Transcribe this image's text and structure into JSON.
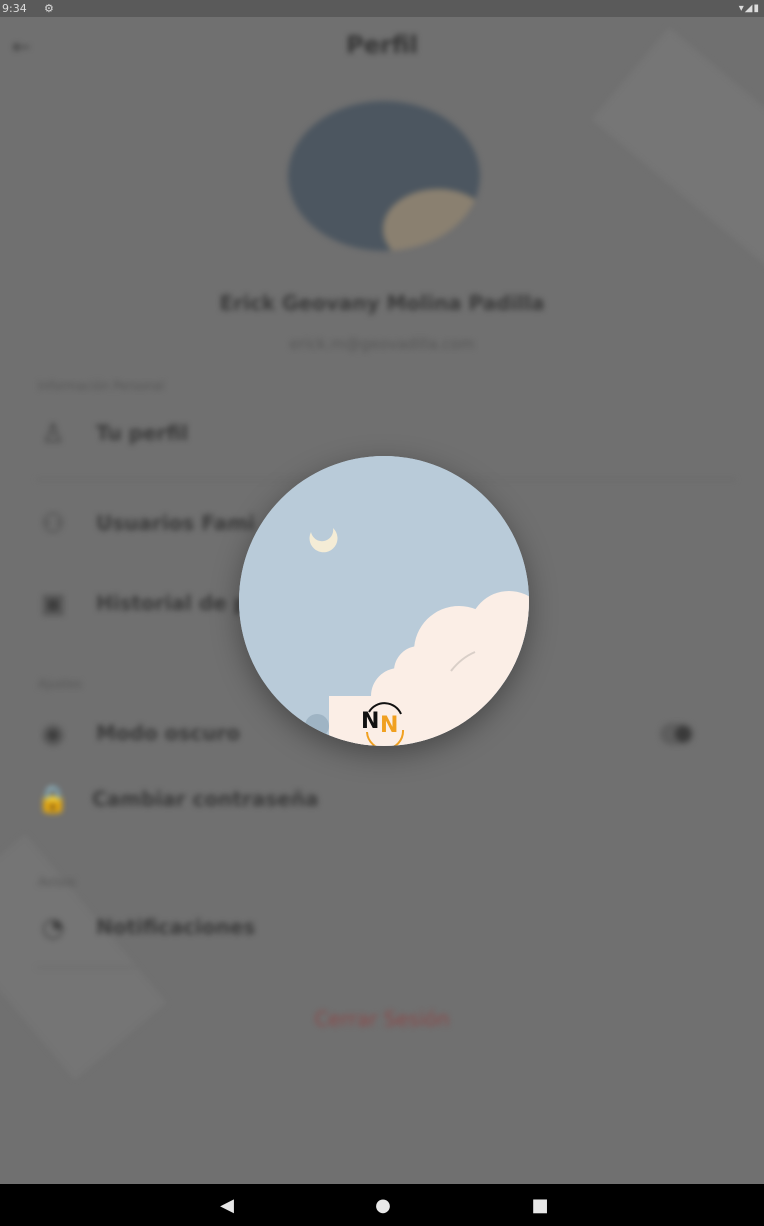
{
  "status_bar": {
    "time": "9:34",
    "settings_icon": "gear-icon",
    "system_icons": "wifi-icon signal-icon battery-icon"
  },
  "background_page": {
    "title": "Perfil",
    "user_name": "Erick Geovany Molina Padilla",
    "user_email": "erick.m@geovadilla.com",
    "sections": {
      "personal": "Información Personal",
      "settings": "Ajustes",
      "notices": "Avisos"
    },
    "items": {
      "profile": "Tu perfil",
      "family": "Usuarios Fami",
      "history": "Historial de p",
      "dark_mode": "Modo oscuro",
      "password": "Cambiar contraseña",
      "notifications": "Notificaciones"
    },
    "logout": "Cerrar Sesión"
  },
  "dialog": {
    "image_label": "N",
    "image_label2": "N"
  },
  "colors": {
    "sky": "#b9cbd9",
    "cloud": "#fbeee6",
    "overlay": "#6b6b6b",
    "logout": "#8a4a4a"
  }
}
